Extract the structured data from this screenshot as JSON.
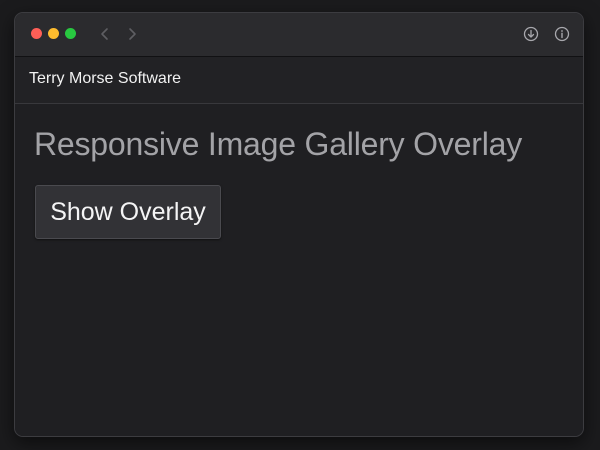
{
  "window": {
    "traffic_lights": {
      "close": "#ff5f57",
      "minimize": "#febc2e",
      "zoom": "#28c840"
    },
    "toolbar_icons": [
      "chevron-left-icon",
      "chevron-right-icon",
      "download-icon",
      "info-icon"
    ]
  },
  "header": {
    "brand": "Terry Morse Software"
  },
  "main": {
    "title": "Responsive Image Gallery Overlay",
    "show_overlay_label": "Show Overlay"
  }
}
